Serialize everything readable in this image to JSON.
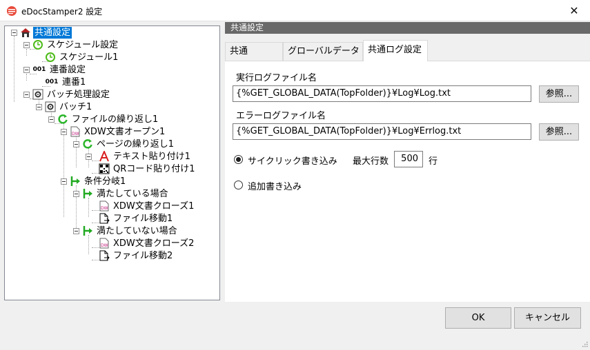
{
  "window": {
    "title": "eDocStamper2 設定",
    "close_glyph": "✕"
  },
  "tree": {
    "nodes": [
      {
        "label": "共通設定",
        "icon": "house-icon",
        "selected": true
      },
      {
        "label": "スケジュール設定",
        "icon": "clock-icon"
      },
      {
        "label": "スケジュール1",
        "icon": "clock-icon"
      },
      {
        "label": "連番設定",
        "icon": "serial-001-icon",
        "prefix": "001"
      },
      {
        "label": "連番1",
        "icon": "serial-001-icon",
        "prefix": "001"
      },
      {
        "label": "バッチ処理設定",
        "icon": "batch-gear-icon"
      },
      {
        "label": "バッチ1",
        "icon": "batch-gear-icon"
      },
      {
        "label": "ファイルの繰り返し1",
        "icon": "loop-icon"
      },
      {
        "label": "XDW文書オープン1",
        "icon": "xdw-doc-icon"
      },
      {
        "label": "ページの繰り返し1",
        "icon": "loop-icon"
      },
      {
        "label": "テキスト貼り付け1",
        "icon": "text-a-icon"
      },
      {
        "label": "QRコード貼り付け1",
        "icon": "qr-code-icon"
      },
      {
        "label": "条件分岐1",
        "icon": "branch-icon"
      },
      {
        "label": "満たしている場合",
        "icon": "branch-icon"
      },
      {
        "label": "XDW文書クローズ1",
        "icon": "xdw-doc-icon"
      },
      {
        "label": "ファイル移動1",
        "icon": "file-move-icon"
      },
      {
        "label": "満たしていない場合",
        "icon": "branch-icon"
      },
      {
        "label": "XDW文書クローズ2",
        "icon": "xdw-doc-icon"
      },
      {
        "label": "ファイル移動2",
        "icon": "file-move-icon"
      }
    ]
  },
  "panel": {
    "header": "共通設定",
    "tabs": [
      {
        "label": "共通"
      },
      {
        "label": "グローバルデータ"
      },
      {
        "label": "共通ログ設定",
        "active": true
      }
    ],
    "exec_log": {
      "label": "実行ログファイル名",
      "value": "{%GET_GLOBAL_DATA(TopFolder)}¥Log¥Log.txt",
      "browse": "参照..."
    },
    "error_log": {
      "label": "エラーログファイル名",
      "value": "{%GET_GLOBAL_DATA(TopFolder)}¥Log¥Errlog.txt",
      "browse": "参照..."
    },
    "write_mode": {
      "cyclic_label": "サイクリック書き込み",
      "cyclic_checked": true,
      "max_lines_label": "最大行数",
      "max_lines_value": "500",
      "max_lines_unit": "行",
      "append_label": "追加書き込み",
      "append_checked": false
    }
  },
  "footer": {
    "ok": "OK",
    "cancel": "キャンセル"
  },
  "colors": {
    "selection": "#0078d7",
    "header": "#696969",
    "clock": "#4cbb17",
    "branch": "#22aa22",
    "text_icon": "#d81e1e"
  }
}
